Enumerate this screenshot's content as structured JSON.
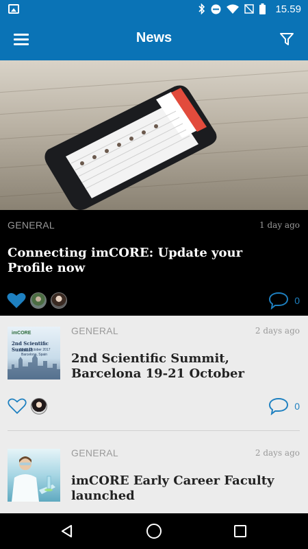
{
  "status_bar": {
    "time": "15.59",
    "icons": [
      "image-icon",
      "bluetooth-icon",
      "do-not-disturb-icon",
      "wifi-icon",
      "no-sim-icon",
      "battery-icon"
    ]
  },
  "app_bar": {
    "title": "News",
    "menu_icon": "menu-icon",
    "filter_icon": "filter-icon"
  },
  "featured": {
    "category": "GENERAL",
    "date": "1 day ago",
    "headline": "Connecting imCORE: Update your Profile now",
    "liked": true,
    "comment_count": "0"
  },
  "articles": [
    {
      "category": "GENERAL",
      "date": "2 days ago",
      "headline": "2nd Scientific Summit, Barcelona 19-21 October",
      "liked": false,
      "comment_count": "0",
      "thumb_text": [
        "imCORE",
        "2nd Scientific Summit",
        "19-21 October 2017",
        "Barcelona, Spain"
      ]
    },
    {
      "category": "GENERAL",
      "date": "2 days ago",
      "headline": "imCORE Early Career Faculty launched"
    }
  ],
  "colors": {
    "primary": "#0a73b6",
    "accent": "#1e80c0"
  }
}
